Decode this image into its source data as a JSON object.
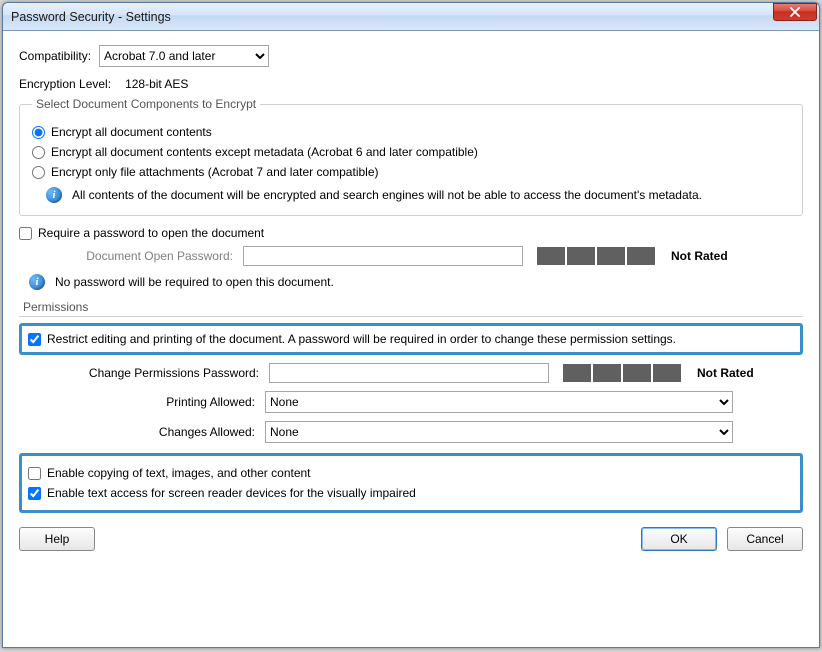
{
  "window": {
    "title": "Password Security - Settings",
    "closeGlyph": "×"
  },
  "compat": {
    "label": "Compatibility:",
    "selected": "Acrobat 7.0 and later",
    "options": [
      "Acrobat 7.0 and later"
    ]
  },
  "encryption": {
    "label": "Encryption Level:",
    "value": "128-bit AES"
  },
  "components": {
    "legend": "Select Document Components to Encrypt",
    "r1": "Encrypt all document contents",
    "r2": "Encrypt all document contents except metadata (Acrobat 6 and later compatible)",
    "r3": "Encrypt only file attachments (Acrobat 7 and later compatible)",
    "info": "All contents of the document will be encrypted and search engines will not be able to access the document's metadata."
  },
  "openpw": {
    "check": "Require a password to open the document",
    "label": "Document Open Password:",
    "value": "",
    "rating": "Not Rated",
    "info": "No password will be required to open this document."
  },
  "permissions": {
    "title": "Permissions",
    "restrict": "Restrict editing and printing of the document. A password will be required in order to change these permission settings.",
    "pwlabel": "Change Permissions Password:",
    "pwvalue": "",
    "pwRating": "Not Rated",
    "printLabel": "Printing Allowed:",
    "printValue": "None",
    "changesLabel": "Changes Allowed:",
    "changesValue": "None",
    "enableCopy": "Enable copying of text, images, and other content",
    "enableAccess": "Enable text access for screen reader devices for the visually impaired"
  },
  "buttons": {
    "help": "Help",
    "ok": "OK",
    "cancel": "Cancel"
  }
}
